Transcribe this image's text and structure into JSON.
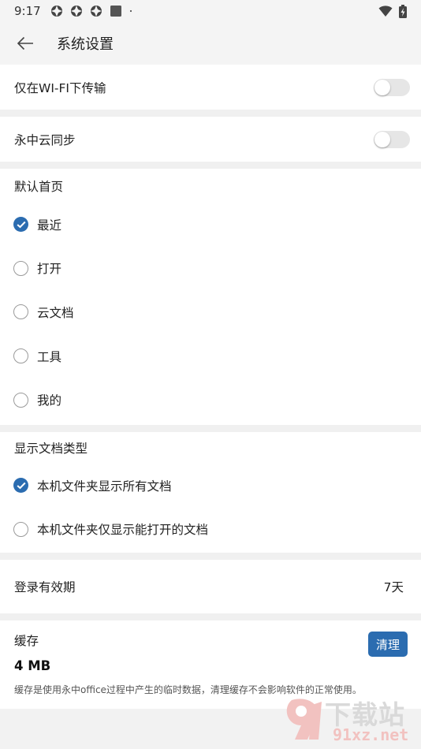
{
  "status_bar": {
    "time": "9:17",
    "left_icons": [
      "app-notification-icon",
      "app-notification-icon",
      "app-notification-icon",
      "square-icon",
      "dot-icon"
    ],
    "right_icons": [
      "wifi-icon",
      "battery-charging-icon"
    ]
  },
  "header": {
    "title": "系统设置"
  },
  "settings": {
    "wifi_only": {
      "label": "仅在WI-FI下传输",
      "enabled": false
    },
    "cloud_sync": {
      "label": "永中云同步",
      "enabled": false
    }
  },
  "default_home": {
    "title": "默认首页",
    "options": [
      {
        "label": "最近",
        "selected": true
      },
      {
        "label": "打开",
        "selected": false
      },
      {
        "label": "云文档",
        "selected": false
      },
      {
        "label": "工具",
        "selected": false
      },
      {
        "label": "我的",
        "selected": false
      }
    ]
  },
  "doc_type": {
    "title": "显示文档类型",
    "options": [
      {
        "label": "本机文件夹显示所有文档",
        "selected": true
      },
      {
        "label": "本机文件夹仅显示能打开的文档",
        "selected": false
      }
    ]
  },
  "login": {
    "label": "登录有效期",
    "value": "7天"
  },
  "cache": {
    "label": "缓存",
    "size": "4 MB",
    "clear_label": "清理",
    "note": "缓存是使用永中office过程中产生的临时数据，清理缓存不会影响软件的正常使用。"
  },
  "watermark": {
    "text": "下载站",
    "url": "91xz.net"
  },
  "colors": {
    "accent": "#2b6cb0",
    "background": "#f2f2f2",
    "card": "#ffffff"
  }
}
